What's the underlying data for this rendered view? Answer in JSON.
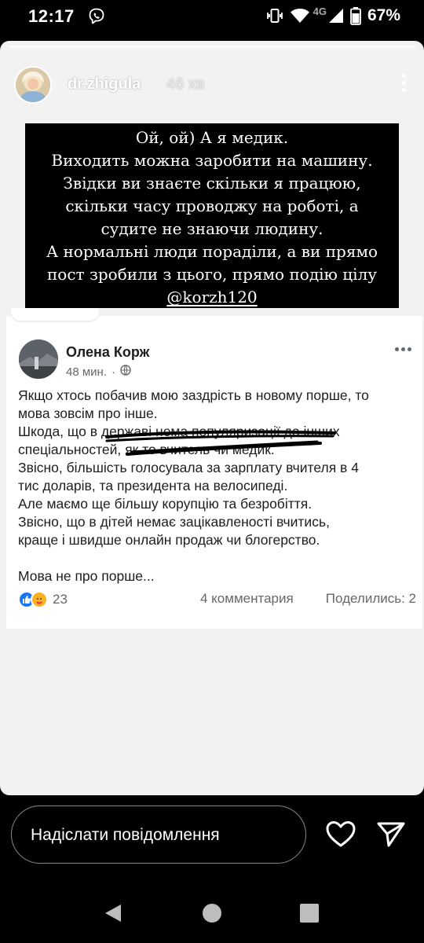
{
  "status_bar": {
    "time": "12:17",
    "battery": "67%",
    "network": "4G"
  },
  "story": {
    "username": "dr.zhigula",
    "time_ago": "46 хв",
    "caption": {
      "lines": [
        "Ой, ой) А я медик.",
        "Виходить можна заробити на машину.",
        "Звідки ви знаєте скільки я працюю,",
        "скільки часу проводжу на роботі, а",
        "судите не знаючи людину.",
        "А нормальні люди порадiли, а ви прямо",
        "пост зробили з цього, прямо подію цілу"
      ],
      "mention": "@korzh120"
    },
    "post": {
      "author": "Олена Корж",
      "time": "48 мин.",
      "body": [
        "Якщо хтось побачив мою заздрість  в новому порше, то",
        "мова зовсім про інше.",
        "Шкода, що в державі нема популяризації до інших",
        "спеціальностей, як то вчитель чи медик.",
        "Звісно,  більшість голосувала за зарплату вчителя в 4",
        "тис доларів,  та президента на велосипеді.",
        "Але маємо ще більшу корупцію та безробіття.",
        "Звісно,  що в дітей немає зацікавленості вчитись,",
        "краще і швидше онлайн продаж чи блогерство.",
        "",
        "Мова не про порше..."
      ],
      "reactions_count": "23",
      "comments": "4 комментария",
      "shares": "Поделились: 2"
    }
  },
  "reply": {
    "placeholder": "Надіслати повідомлення"
  },
  "icons": {
    "viber": "viber-icon",
    "vibrate": "vibrate-icon",
    "wifi": "wifi-icon",
    "signal": "signal-icon",
    "battery": "battery-icon",
    "heart": "heart-icon",
    "send": "send-icon",
    "back": "back-icon",
    "home": "home-icon",
    "recents": "recents-icon"
  },
  "colors": {
    "fb_like": "#1877f2",
    "fb_care": "#f7b125",
    "story_bg": "#f2f2f2"
  }
}
